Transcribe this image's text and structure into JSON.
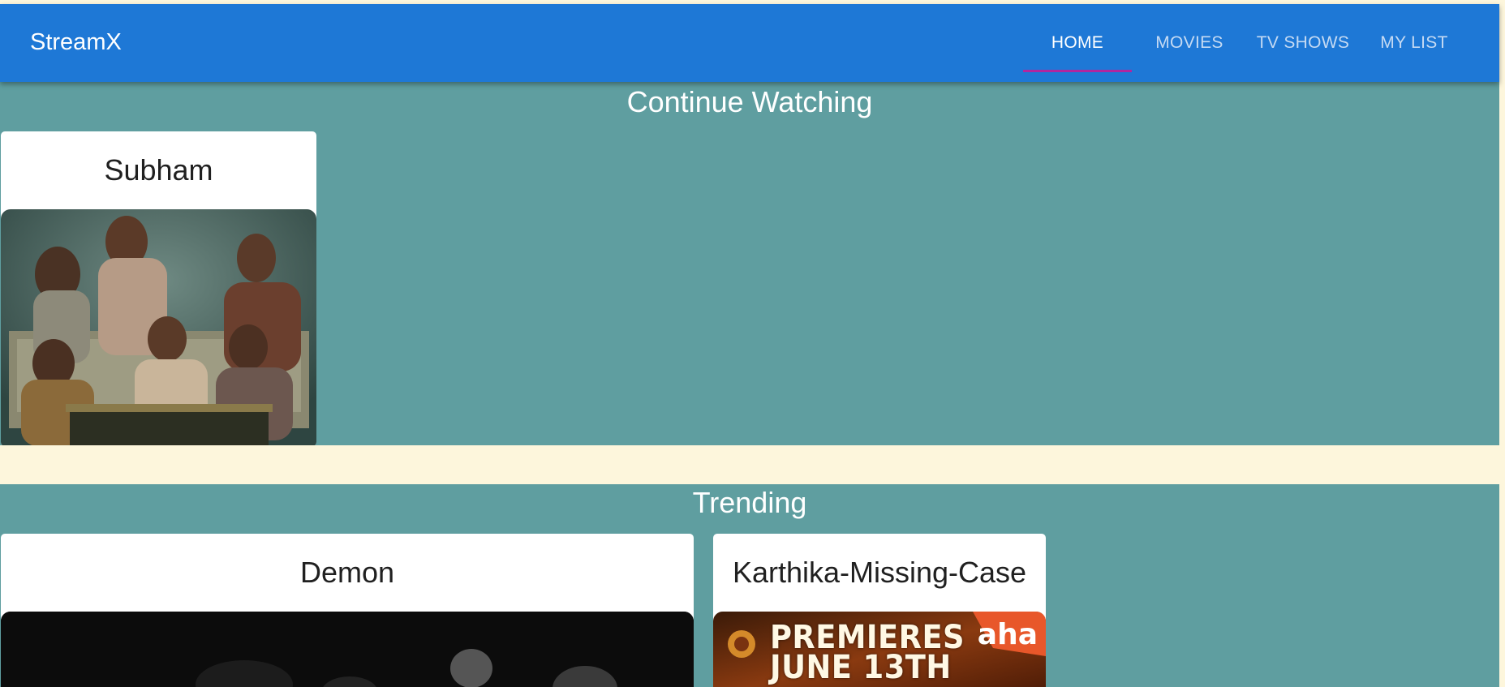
{
  "app": {
    "brand": "StreamX"
  },
  "nav": {
    "tabs": [
      {
        "label": "HOME",
        "active": true
      },
      {
        "label": "MOVIES",
        "active": false
      },
      {
        "label": "TV SHOWS",
        "active": false
      },
      {
        "label": "MY LIST",
        "active": false
      }
    ]
  },
  "continue_watching": {
    "title": "Continue Watching",
    "items": [
      {
        "title": "Subham"
      }
    ]
  },
  "trending": {
    "title": "Trending",
    "items": [
      {
        "title": "Demon"
      },
      {
        "title": "Karthika-Missing-Case",
        "poster_text": "PREMIERES JUNE 13TH",
        "poster_logo": "aha"
      }
    ]
  },
  "colors": {
    "appbar": "#1e78d6",
    "active_indicator": "#b1279f",
    "section_bg": "#5f9ea0",
    "page_bg": "#fdf6dc"
  }
}
